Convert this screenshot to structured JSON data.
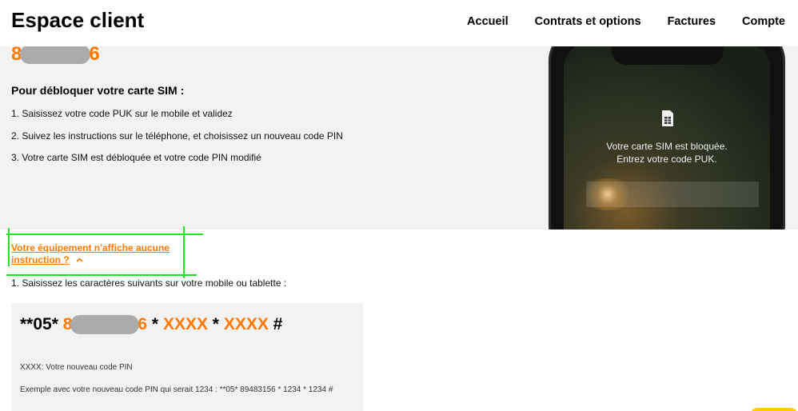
{
  "header": {
    "title": "Espace client",
    "nav": [
      {
        "label": "Accueil"
      },
      {
        "label": "Contrats et options"
      },
      {
        "label": "Factures"
      },
      {
        "label": "Compte"
      }
    ]
  },
  "puk": {
    "prefix": "8",
    "suffix": "6"
  },
  "sim_section": {
    "title": "Pour débloquer votre carte SIM :",
    "steps": [
      "1. Saisissez votre code PUK sur le mobile et validez",
      "2. Suivez les instructions sur le téléphone, et choisissez un nouveau code PIN",
      "3. Votre carte SIM est débloquée et votre code PIN modifié"
    ]
  },
  "phone": {
    "message": "Votre carte SIM est bloquée.\nEntrez votre code PUK.",
    "icon": "sim-card-icon"
  },
  "toggle": {
    "label": "Votre équipement n'affiche aucune instruction ?",
    "icon": "chevron-up-icon"
  },
  "instruction": "1. Saisissez les caractères suivants sur votre mobile ou tablette :",
  "code": {
    "prefix": "**05* ",
    "puk_prefix": "8",
    "puk_suffix": "6",
    "sep1": " * ",
    "pin1": "XXXX",
    "sep2": " * ",
    "pin2": "XXXX",
    "end": " #",
    "legend": "XXXX: Votre nouveau code PIN",
    "example": "Exemple avec votre nouveau code PIN qui serait 1234 : **05* 89483156 * 1234 * 1234 #"
  },
  "colors": {
    "accent": "#ff7900",
    "highlight": "#22e022",
    "panel": "#f2f2f2"
  }
}
